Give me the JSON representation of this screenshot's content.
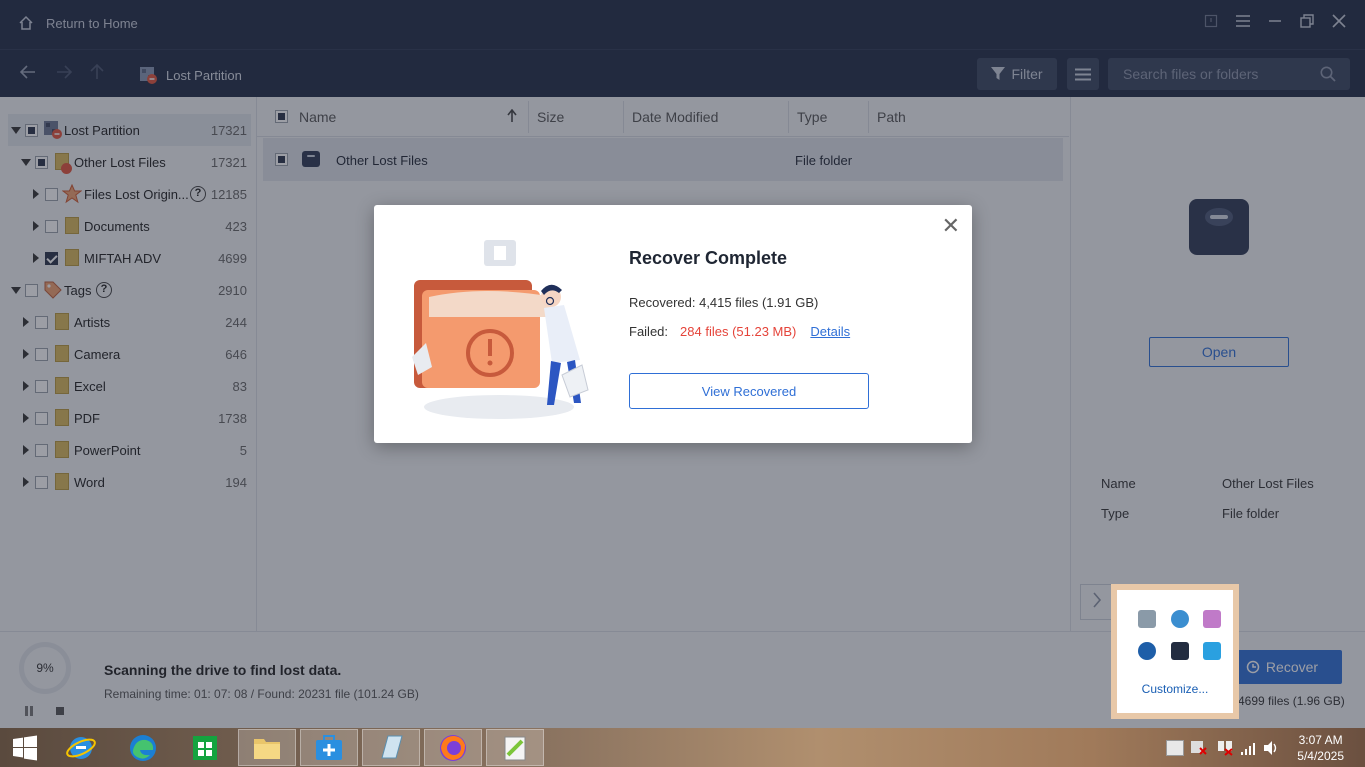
{
  "titlebar": {
    "home_label": "Return to Home"
  },
  "toolbar": {
    "breadcrumb": "Lost Partition",
    "filter_label": "Filter",
    "search_placeholder": "Search files or folders"
  },
  "tree": [
    {
      "label": "Lost Partition",
      "count": "17321"
    },
    {
      "label": "Other Lost Files",
      "count": "17321"
    },
    {
      "label": "Files Lost Origin...",
      "count": "12185"
    },
    {
      "label": "Documents",
      "count": "423"
    },
    {
      "label": "MIFTAH ADV",
      "count": "4699"
    },
    {
      "label": "Tags",
      "count": "2910"
    },
    {
      "label": "Artists",
      "count": "244"
    },
    {
      "label": "Camera",
      "count": "646"
    },
    {
      "label": "Excel",
      "count": "83"
    },
    {
      "label": "PDF",
      "count": "1738"
    },
    {
      "label": "PowerPoint",
      "count": "5"
    },
    {
      "label": "Word",
      "count": "194"
    }
  ],
  "list": {
    "columns": {
      "name": "Name",
      "size": "Size",
      "date": "Date Modified",
      "type": "Type",
      "path": "Path"
    },
    "rows": [
      {
        "name": "Other Lost Files",
        "type": "File folder"
      }
    ]
  },
  "details": {
    "open_label": "Open",
    "name_key": "Name",
    "name_value": "Other Lost Files",
    "type_key": "Type",
    "type_value": "File folder"
  },
  "status": {
    "progress": "9%",
    "title": "Scanning the drive to find lost data.",
    "subtitle": "Remaining time: 01: 07: 08 / Found: 20231 file (101.24 GB)",
    "recover_label": "Recover",
    "recover_info": "4699 files (1.96 GB)"
  },
  "dialog": {
    "title": "Recover Complete",
    "recovered": "Recovered: 4,415 files (1.91 GB)",
    "failed_label": "Failed:",
    "failed_value": "284 files (51.23 MB)",
    "details_link": "Details",
    "button": "View Recovered"
  },
  "traypopup": {
    "customize": "Customize..."
  },
  "taskbar": {
    "time": "3:07 AM",
    "date": "5/4/2025"
  },
  "colors": {
    "accent": "#2f6fd6",
    "header": "#222d45",
    "error": "#e5443a"
  }
}
